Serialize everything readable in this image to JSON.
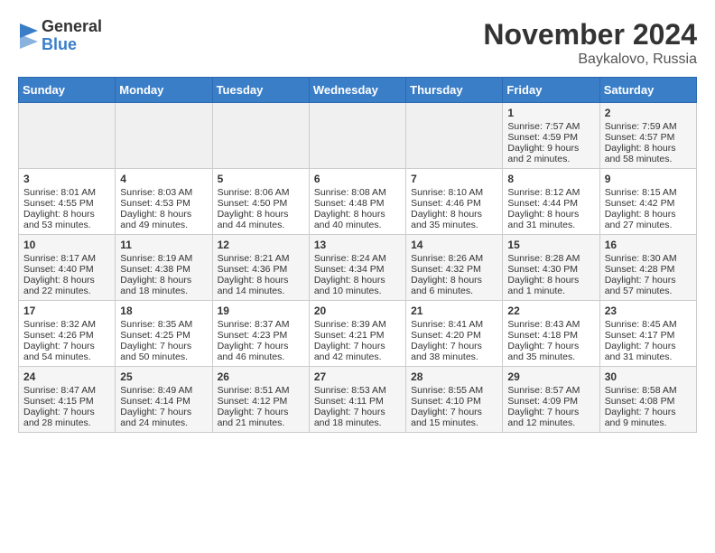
{
  "header": {
    "logo_general": "General",
    "logo_blue": "Blue",
    "title": "November 2024",
    "location": "Baykalovo, Russia"
  },
  "days_of_week": [
    "Sunday",
    "Monday",
    "Tuesday",
    "Wednesday",
    "Thursday",
    "Friday",
    "Saturday"
  ],
  "weeks": [
    [
      {
        "day": "",
        "info": ""
      },
      {
        "day": "",
        "info": ""
      },
      {
        "day": "",
        "info": ""
      },
      {
        "day": "",
        "info": ""
      },
      {
        "day": "",
        "info": ""
      },
      {
        "day": "1",
        "info": "Sunrise: 7:57 AM\nSunset: 4:59 PM\nDaylight: 9 hours\nand 2 minutes."
      },
      {
        "day": "2",
        "info": "Sunrise: 7:59 AM\nSunset: 4:57 PM\nDaylight: 8 hours\nand 58 minutes."
      }
    ],
    [
      {
        "day": "3",
        "info": "Sunrise: 8:01 AM\nSunset: 4:55 PM\nDaylight: 8 hours\nand 53 minutes."
      },
      {
        "day": "4",
        "info": "Sunrise: 8:03 AM\nSunset: 4:53 PM\nDaylight: 8 hours\nand 49 minutes."
      },
      {
        "day": "5",
        "info": "Sunrise: 8:06 AM\nSunset: 4:50 PM\nDaylight: 8 hours\nand 44 minutes."
      },
      {
        "day": "6",
        "info": "Sunrise: 8:08 AM\nSunset: 4:48 PM\nDaylight: 8 hours\nand 40 minutes."
      },
      {
        "day": "7",
        "info": "Sunrise: 8:10 AM\nSunset: 4:46 PM\nDaylight: 8 hours\nand 35 minutes."
      },
      {
        "day": "8",
        "info": "Sunrise: 8:12 AM\nSunset: 4:44 PM\nDaylight: 8 hours\nand 31 minutes."
      },
      {
        "day": "9",
        "info": "Sunrise: 8:15 AM\nSunset: 4:42 PM\nDaylight: 8 hours\nand 27 minutes."
      }
    ],
    [
      {
        "day": "10",
        "info": "Sunrise: 8:17 AM\nSunset: 4:40 PM\nDaylight: 8 hours\nand 22 minutes."
      },
      {
        "day": "11",
        "info": "Sunrise: 8:19 AM\nSunset: 4:38 PM\nDaylight: 8 hours\nand 18 minutes."
      },
      {
        "day": "12",
        "info": "Sunrise: 8:21 AM\nSunset: 4:36 PM\nDaylight: 8 hours\nand 14 minutes."
      },
      {
        "day": "13",
        "info": "Sunrise: 8:24 AM\nSunset: 4:34 PM\nDaylight: 8 hours\nand 10 minutes."
      },
      {
        "day": "14",
        "info": "Sunrise: 8:26 AM\nSunset: 4:32 PM\nDaylight: 8 hours\nand 6 minutes."
      },
      {
        "day": "15",
        "info": "Sunrise: 8:28 AM\nSunset: 4:30 PM\nDaylight: 8 hours\nand 1 minute."
      },
      {
        "day": "16",
        "info": "Sunrise: 8:30 AM\nSunset: 4:28 PM\nDaylight: 7 hours\nand 57 minutes."
      }
    ],
    [
      {
        "day": "17",
        "info": "Sunrise: 8:32 AM\nSunset: 4:26 PM\nDaylight: 7 hours\nand 54 minutes."
      },
      {
        "day": "18",
        "info": "Sunrise: 8:35 AM\nSunset: 4:25 PM\nDaylight: 7 hours\nand 50 minutes."
      },
      {
        "day": "19",
        "info": "Sunrise: 8:37 AM\nSunset: 4:23 PM\nDaylight: 7 hours\nand 46 minutes."
      },
      {
        "day": "20",
        "info": "Sunrise: 8:39 AM\nSunset: 4:21 PM\nDaylight: 7 hours\nand 42 minutes."
      },
      {
        "day": "21",
        "info": "Sunrise: 8:41 AM\nSunset: 4:20 PM\nDaylight: 7 hours\nand 38 minutes."
      },
      {
        "day": "22",
        "info": "Sunrise: 8:43 AM\nSunset: 4:18 PM\nDaylight: 7 hours\nand 35 minutes."
      },
      {
        "day": "23",
        "info": "Sunrise: 8:45 AM\nSunset: 4:17 PM\nDaylight: 7 hours\nand 31 minutes."
      }
    ],
    [
      {
        "day": "24",
        "info": "Sunrise: 8:47 AM\nSunset: 4:15 PM\nDaylight: 7 hours\nand 28 minutes."
      },
      {
        "day": "25",
        "info": "Sunrise: 8:49 AM\nSunset: 4:14 PM\nDaylight: 7 hours\nand 24 minutes."
      },
      {
        "day": "26",
        "info": "Sunrise: 8:51 AM\nSunset: 4:12 PM\nDaylight: 7 hours\nand 21 minutes."
      },
      {
        "day": "27",
        "info": "Sunrise: 8:53 AM\nSunset: 4:11 PM\nDaylight: 7 hours\nand 18 minutes."
      },
      {
        "day": "28",
        "info": "Sunrise: 8:55 AM\nSunset: 4:10 PM\nDaylight: 7 hours\nand 15 minutes."
      },
      {
        "day": "29",
        "info": "Sunrise: 8:57 AM\nSunset: 4:09 PM\nDaylight: 7 hours\nand 12 minutes."
      },
      {
        "day": "30",
        "info": "Sunrise: 8:58 AM\nSunset: 4:08 PM\nDaylight: 7 hours\nand 9 minutes."
      }
    ]
  ]
}
